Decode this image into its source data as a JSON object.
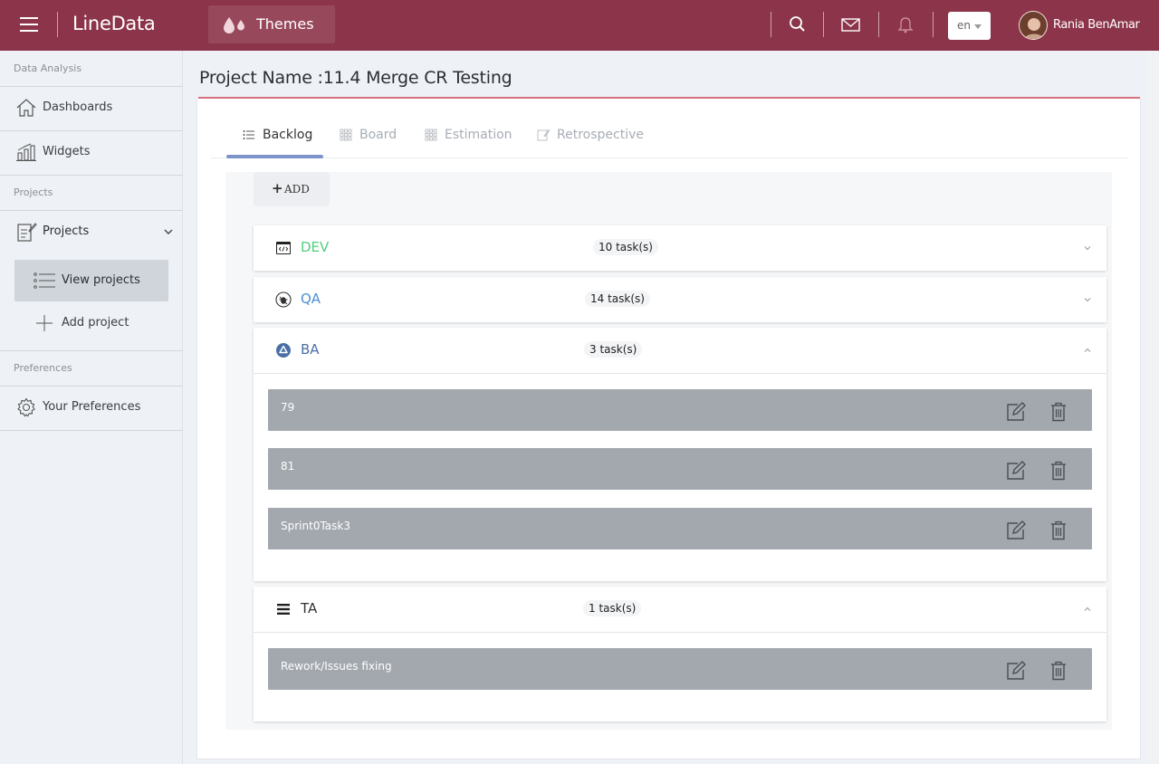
{
  "topbar": {
    "brand": "LineData",
    "themes_label": "Themes",
    "language": "en",
    "user_name": "Rania BenAmar",
    "bg_color": "#8c3449"
  },
  "sidebar": {
    "section_data_analysis": "Data Analysis",
    "dashboards": "Dashboards",
    "widgets": "Widgets",
    "section_projects": "Projects",
    "projects": "Projects",
    "view_projects": "View projects",
    "add_project": "Add project",
    "section_preferences": "Preferences",
    "your_preferences": "Your Preferences"
  },
  "main": {
    "page_title": "Project Name :11.4 Merge CR Testing",
    "tabs": [
      {
        "label": "Backlog",
        "icon": "list-icon",
        "active": true
      },
      {
        "label": "Board",
        "icon": "grid-icon",
        "active": false
      },
      {
        "label": "Estimation",
        "icon": "grid-icon",
        "active": false
      },
      {
        "label": "Retrospective",
        "icon": "edit-note-icon",
        "active": false
      }
    ],
    "add_label": "ADD",
    "groups": [
      {
        "name": "DEV",
        "count": "10 task(s)",
        "color": "#4fcf7a",
        "icon": "code-window-icon",
        "expanded": false,
        "tasks": []
      },
      {
        "name": "QA",
        "count": "14 task(s)",
        "color": "#4d8fd1",
        "icon": "bug-icon",
        "expanded": false,
        "tasks": []
      },
      {
        "name": "BA",
        "count": "3 task(s)",
        "color": "#4a6fa5",
        "icon": "triangle-circle-icon",
        "expanded": true,
        "tasks": [
          "79",
          "81",
          "Sprint0Task3"
        ]
      },
      {
        "name": "TA",
        "count": "1 task(s)",
        "color": "#333333",
        "icon": "bars-icon",
        "expanded": true,
        "tasks": [
          "Rework/Issues fixing"
        ]
      }
    ]
  }
}
